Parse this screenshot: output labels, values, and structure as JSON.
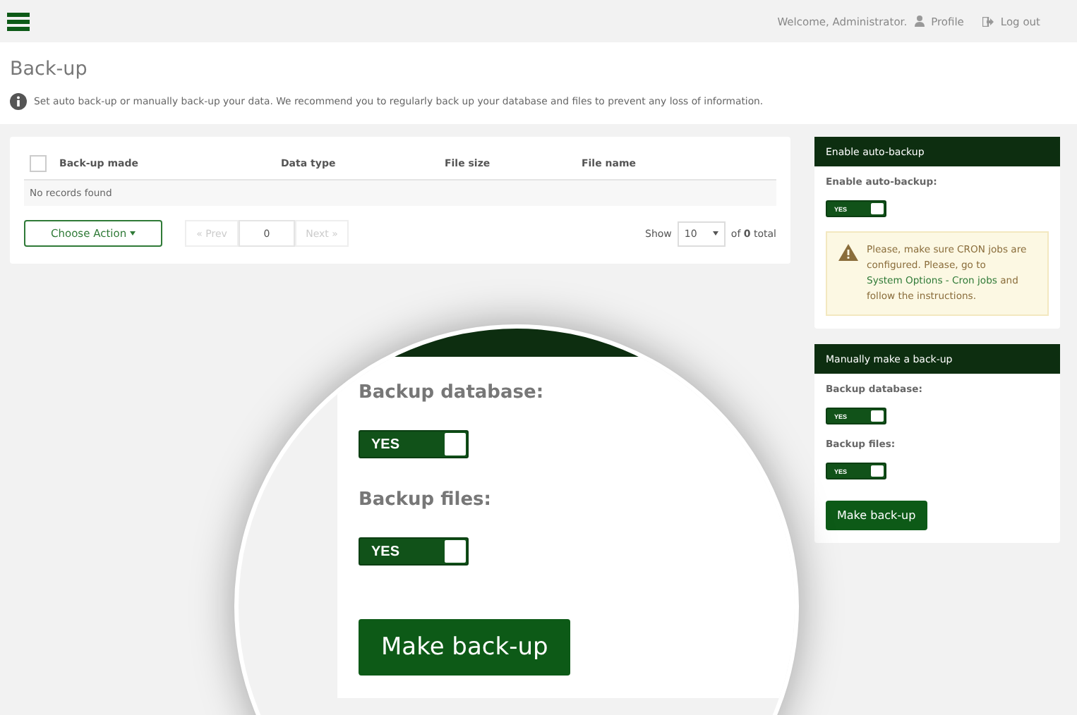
{
  "topbar": {
    "welcome": "Welcome, Administrator.",
    "links": [
      {
        "kind": "profile",
        "label": "Profile"
      },
      {
        "kind": "logout",
        "label": "Log out"
      }
    ]
  },
  "page": {
    "title": "Back-up",
    "info": "Set auto back-up or manually back-up your data. We recommend you to regularly back up your database and files to prevent any loss of information."
  },
  "table": {
    "select_all_checked": false,
    "columns": [
      "Back-up made",
      "Data type",
      "File size",
      "File name"
    ],
    "empty_message": "No records found"
  },
  "footer": {
    "action": "Choose Action",
    "prev": "« Prev",
    "page": "0",
    "next": "Next »",
    "prev_disabled": true,
    "next_disabled": true,
    "show_label": "Show",
    "page_size": "10",
    "total_prefix": "of",
    "total": "0",
    "total_suffix": "total"
  },
  "auto_backup": {
    "title": "Enable auto-backup",
    "label": "Enable auto-backup:",
    "toggle": {
      "label": "YES",
      "on": true
    },
    "warning": {
      "text_before": "Please, make sure CRON jobs are configured. Please, go to",
      "link": "System Options - Cron jobs",
      "text_after": "and follow the instructions."
    }
  },
  "manual_backup": {
    "title": "Manually make a back-up",
    "fields": [
      {
        "label": "Backup database:",
        "toggle": {
          "label": "YES",
          "on": true
        }
      },
      {
        "label": "Backup files:",
        "toggle": {
          "label": "YES",
          "on": true
        }
      }
    ],
    "button": "Make back-up"
  },
  "magnifier": {
    "fields": [
      {
        "label": "Backup database:",
        "toggle": {
          "label": "YES",
          "on": true
        }
      },
      {
        "label": "Backup files:",
        "toggle": {
          "label": "YES",
          "on": true
        }
      }
    ],
    "button": "Make back-up"
  }
}
